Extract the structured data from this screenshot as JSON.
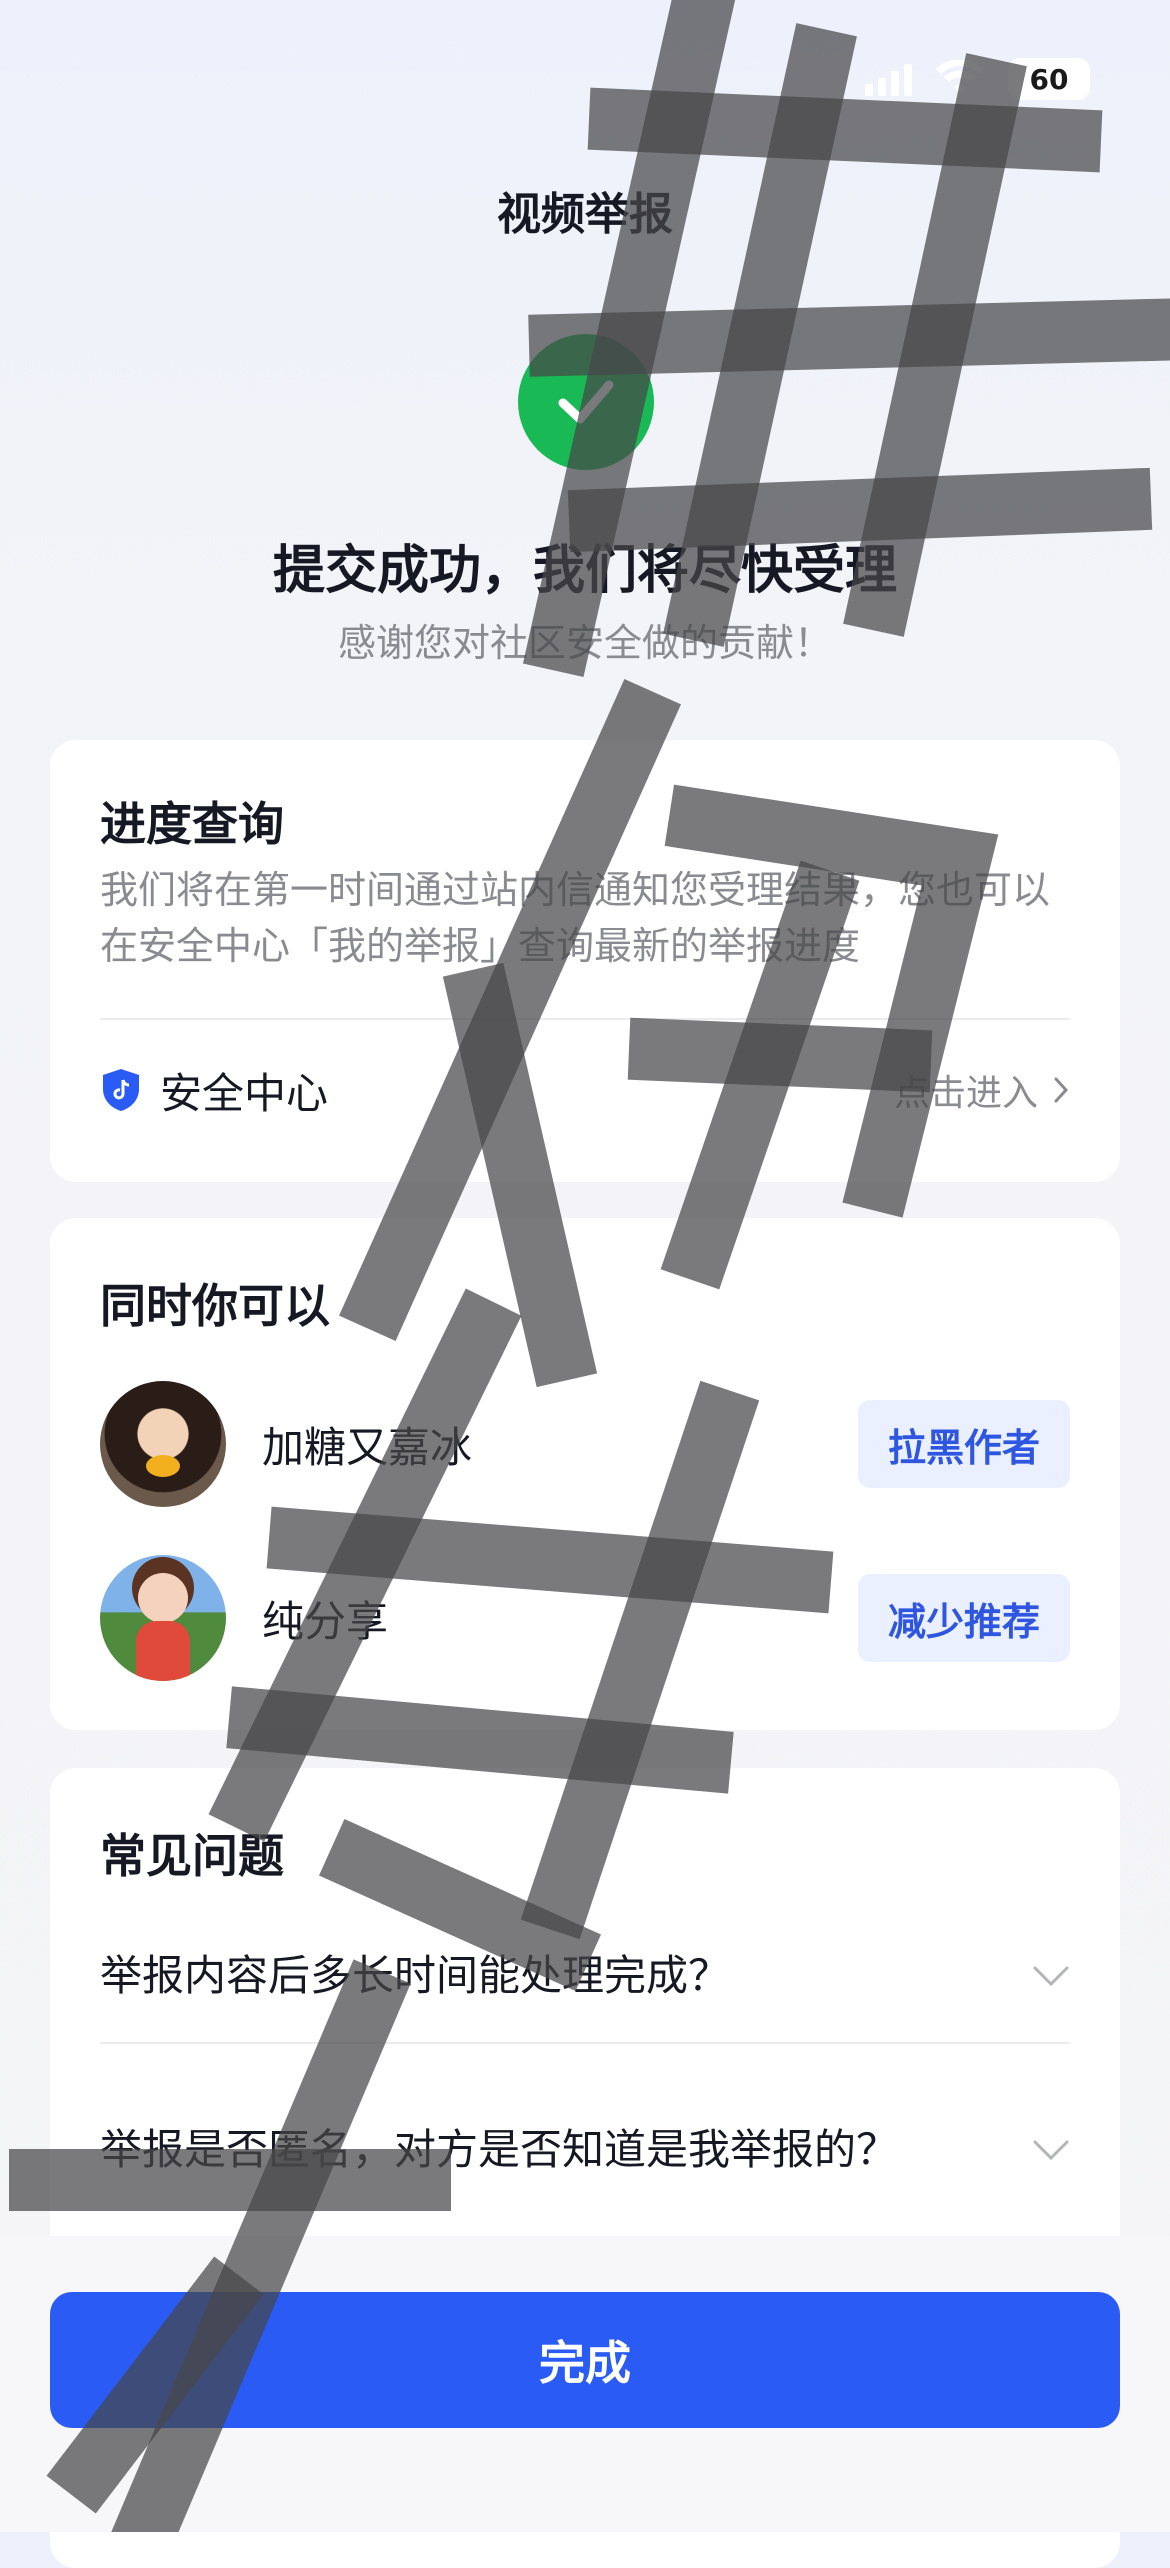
{
  "status_bar": {
    "battery": "60",
    "battery_color": "#ffffff"
  },
  "header": {
    "title": "视频举报"
  },
  "success": {
    "title": "提交成功，我们将尽快受理",
    "subtitle": "感谢您对社区安全做的贡献！",
    "icon": "check-icon",
    "color": "#19b955"
  },
  "progress_card": {
    "title": "进度查询",
    "description": "我们将在第一时间通过站内信通知您受理结果，您也可以在安全中心「我的举报」查询最新的举报进度",
    "security_center": {
      "label": "安全中心",
      "action": "点击进入",
      "icon": "shield-icon"
    }
  },
  "also_card": {
    "title": "同时你可以",
    "users": [
      {
        "name": "加糖又嘉冰",
        "action": "拉黑作者"
      },
      {
        "name": "纯分享",
        "action": "减少推荐"
      }
    ]
  },
  "faq_card": {
    "title": "常见问题",
    "items": [
      {
        "question": "举报内容后多长时间能处理完成？"
      },
      {
        "question": "举报是否匿名，对方是否知道是我举报的？"
      }
    ]
  },
  "done_button": {
    "label": "完成",
    "color": "#2a5cf5"
  },
  "watermark": {
    "text": "拙阶织"
  },
  "colors": {
    "accent": "#2a5cf5",
    "accent_light": "#eaf0ff",
    "accent_text": "#2f56e0",
    "muted_text": "#8a8b91"
  }
}
